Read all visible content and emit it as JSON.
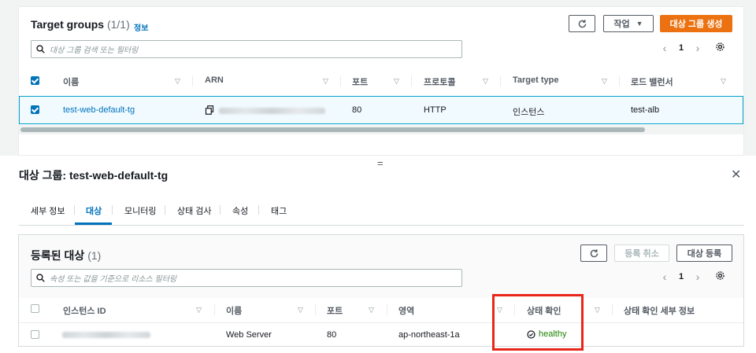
{
  "target_groups": {
    "title": "Target groups",
    "count": "(1/1)",
    "info": "정보",
    "actions_label": "작업",
    "create_label": "대상 그룹 생성",
    "search_placeholder": "대상 그룹 검색 또는 필터링",
    "page": "1",
    "columns": [
      "이름",
      "ARN",
      "포트",
      "프로토콜",
      "Target type",
      "로드 밸런서"
    ],
    "row": {
      "name": "test-web-default-tg",
      "port": "80",
      "protocol": "HTTP",
      "target_type": "인스턴스",
      "load_balancer": "test-alb",
      "checked": true
    }
  },
  "details": {
    "title": "대상 그룹: test-web-default-tg",
    "drag_handle": "=",
    "close": "✕",
    "tabs": [
      "세부 정보",
      "대상",
      "모니터링",
      "상태 검사",
      "속성",
      "태그"
    ],
    "active_tab": "대상"
  },
  "registered_targets": {
    "title": "등록된 대상",
    "count": "(1)",
    "deregister_label": "등록 취소",
    "register_label": "대상 등록",
    "search_placeholder": "속성 또는 값을 기준으로 리소스 필터링",
    "page": "1",
    "columns": [
      "인스턴스 ID",
      "이름",
      "포트",
      "영역",
      "상태 확인",
      "상태 확인 세부 정보"
    ],
    "row": {
      "name": "Web Server",
      "port": "80",
      "zone": "ap-northeast-1a",
      "health": "healthy",
      "health_details": ""
    }
  },
  "colors": {
    "primary": "#ec7211",
    "link": "#0073bb",
    "healthy": "#1d8102",
    "highlight": "#e8261a"
  }
}
